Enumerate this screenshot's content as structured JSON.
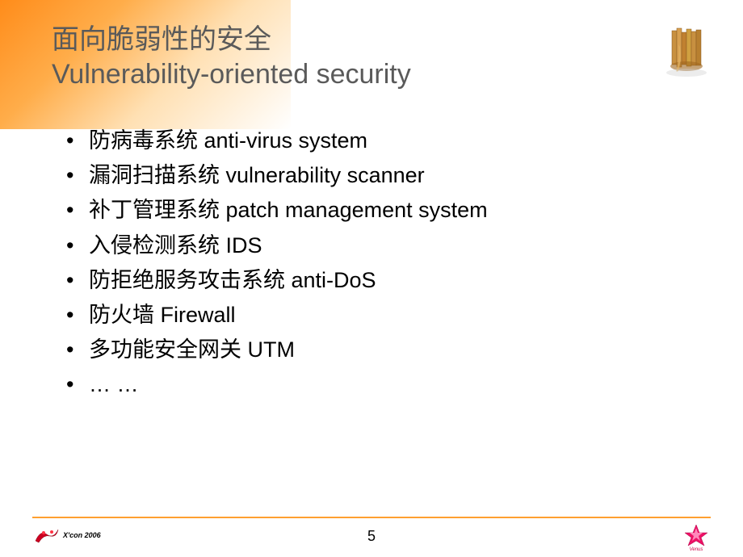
{
  "header": {
    "title_cn": "面向脆弱性的安全",
    "title_en": "Vulnerability-oriented security"
  },
  "bullets": [
    "防病毒系统 anti-virus system",
    "漏洞扫描系统 vulnerability scanner",
    "补丁管理系统 patch management system",
    "入侵检测系统 IDS",
    "防拒绝服务攻击系统 anti-DoS",
    "防火墙 Firewall",
    "多功能安全网关 UTM",
    "… …"
  ],
  "footer": {
    "page_number": "5",
    "logo_left_text": "X'con 2006"
  }
}
